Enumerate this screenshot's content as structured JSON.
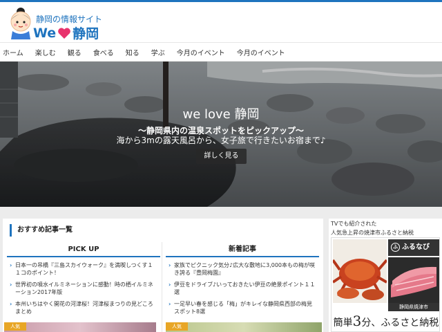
{
  "site": {
    "tagline": "静岡の情報サイト",
    "name_prefix": "We",
    "name_suffix": "静岡",
    "accent": "#1e73be"
  },
  "nav": {
    "items": [
      "ホーム",
      "楽しむ",
      "観る",
      "食べる",
      "知る",
      "学ぶ",
      "今月のイベント",
      "今月のイベント"
    ]
  },
  "hero": {
    "title": "we love 静岡",
    "subtitle1": "〜静岡県内の温泉スポットをピックアップ〜",
    "subtitle2": "海から3mの露天風呂から、女子旅で行きたいお宿まで♪",
    "button_label": "詳しく見る"
  },
  "recommended": {
    "title": "おすすめ記事一覧",
    "pickup": {
      "heading": "PICK UP",
      "items": [
        "日本一の吊橋『三島スカイウォーク』を満喫しつくす１１コのポイント！",
        "世界初の噴水イルミネーションに感動！時の栖イルミネーション2017年版",
        "本州いちはやく開花の河津桜！河津桜まつりの見どころまとめ"
      ]
    },
    "latest": {
      "heading": "新着記事",
      "items": [
        "家族でピクニック気分♪広大な敷地に3,000本もの梅が咲き誇る『豊岡梅園』",
        "伊豆をドライブ♪いっておきたい伊豆の絶景ポイント１１選",
        "一足早い春を感じる「梅」がキレイな静岡県西部の梅見スポット8選"
      ]
    },
    "popular_badge": "人気"
  },
  "sidebar": {
    "ad_line1": "TVでも紹介された",
    "ad_line2": "人気急上昇の焼津市ふるさと納税",
    "brand": "ふるなび",
    "location": "静岡県焼津市",
    "tagline_pre": "簡単",
    "tagline_num": "3",
    "tagline_post": "分、ふるさと納税"
  }
}
